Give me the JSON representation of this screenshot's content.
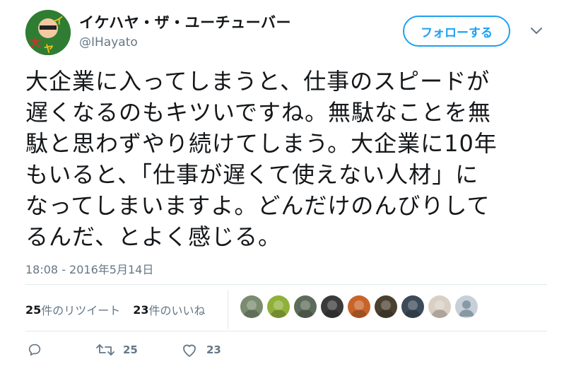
{
  "user": {
    "display_name": "イケハヤ・ザ・ユーチューバー",
    "handle": "@IHayato",
    "avatar_colors": [
      "#2e7d32",
      "#f5c518",
      "#d32f2f"
    ]
  },
  "follow_button": {
    "label": "フォローする",
    "color": "#1da1f2"
  },
  "tweet": {
    "text": "大企業に入ってしまうと、仕事のスピードが\n遅くなるのもキツいですね。無駄なことを無\n駄と思わずやり続けてしまう。大企業に10年\nもいると、「仕事が遅くて使えない人材」に\nなってしまいますよ。どんだけのんびりして\nるんだ、とよく感じる。",
    "timestamp": "18:08 - 2016年5月14日"
  },
  "stats": {
    "retweets_count": "25",
    "retweets_label": "件のリツイート",
    "likes_count": "23",
    "likes_label": "件のいいね"
  },
  "likers": [
    {
      "name": "liker-1",
      "color": "#7a8b6f"
    },
    {
      "name": "liker-2",
      "color": "#8fb03a"
    },
    {
      "name": "liker-3",
      "color": "#5d6b5a"
    },
    {
      "name": "liker-4",
      "color": "#3a3a3a"
    },
    {
      "name": "liker-5",
      "color": "#c8642a"
    },
    {
      "name": "liker-6",
      "color": "#4a4030"
    },
    {
      "name": "liker-7",
      "color": "#3d4a5a"
    },
    {
      "name": "liker-8",
      "color": "#d9cfc4"
    },
    {
      "name": "liker-9",
      "color": "#c7d0d8"
    }
  ],
  "actions": {
    "reply_icon": "reply-icon",
    "retweet_icon": "retweet-icon",
    "retweet_count": "25",
    "like_icon": "heart-icon",
    "like_count": "23"
  }
}
